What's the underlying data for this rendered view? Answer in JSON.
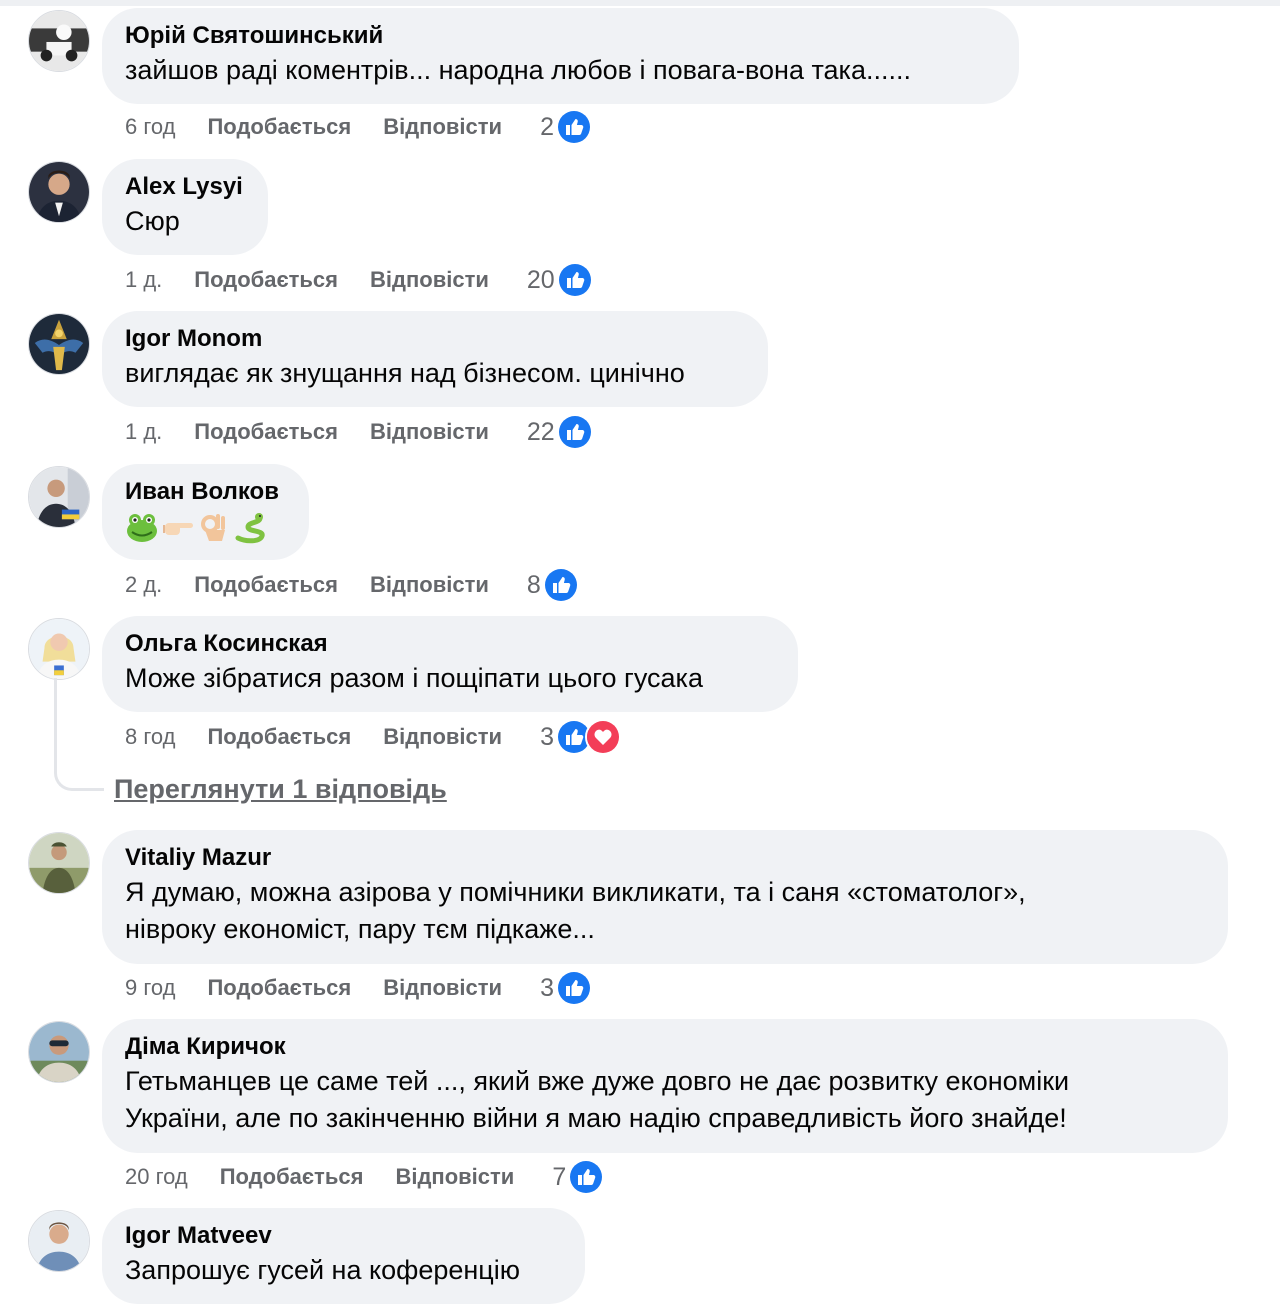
{
  "ui": {
    "like_label": "Подобається",
    "reply_label": "Відповісти"
  },
  "colors": {
    "like_blue": "#1877f2",
    "love_red": "#f33e58",
    "bubble_bg": "#f0f2f5",
    "meta_text": "#65676b"
  },
  "comments": [
    {
      "author": "Юрій Святошинський",
      "text": "зайшов раді коментрів... народна любов і повага-вона така......",
      "time": "6 год",
      "reaction_count": "2",
      "reactions": [
        "like-icon"
      ]
    },
    {
      "author": "Alex Lysyi",
      "text": "Сюр",
      "time": "1 д.",
      "reaction_count": "20",
      "reactions": [
        "like-icon"
      ]
    },
    {
      "author": "Igor Monom",
      "text": "виглядає як знущання над бізнесом. цинічно",
      "time": "1 д.",
      "reaction_count": "22",
      "reactions": [
        "like-icon"
      ]
    },
    {
      "author": "Иван Волков",
      "text": "",
      "emojis": [
        "frog-emoji",
        "pointing-right-emoji",
        "ok-hand-emoji",
        "snake-emoji"
      ],
      "time": "2 д.",
      "reaction_count": "8",
      "reactions": [
        "like-icon"
      ]
    },
    {
      "author": "Ольга Косинская",
      "text": "Може зібратися разом і пощіпати цього гусака",
      "time": "8 год",
      "reaction_count": "3",
      "reactions": [
        "like-icon",
        "love-icon"
      ],
      "view_replies": "Переглянути 1 відповідь"
    },
    {
      "author": "Vitaliy Mazur",
      "text_lines": [
        "Я думаю, можна азірова у помічники викликати, та і саня «стоматолог»,",
        "нівроку економіст, пару тєм підкаже..."
      ],
      "time": "9 год",
      "reaction_count": "3",
      "reactions": [
        "like-icon"
      ]
    },
    {
      "author": "Діма Киричок",
      "text_lines": [
        "Гетьманцев це саме тей ..., який вже дуже довго не дає розвитку економіки",
        "України, але по закінченню війни я маю надію справедливість його знайде!"
      ],
      "time": "20 год",
      "reaction_count": "7",
      "reactions": [
        "like-icon"
      ]
    },
    {
      "author": "Igor Matveev",
      "text": "Запрошує гусей на коференцію"
    }
  ]
}
